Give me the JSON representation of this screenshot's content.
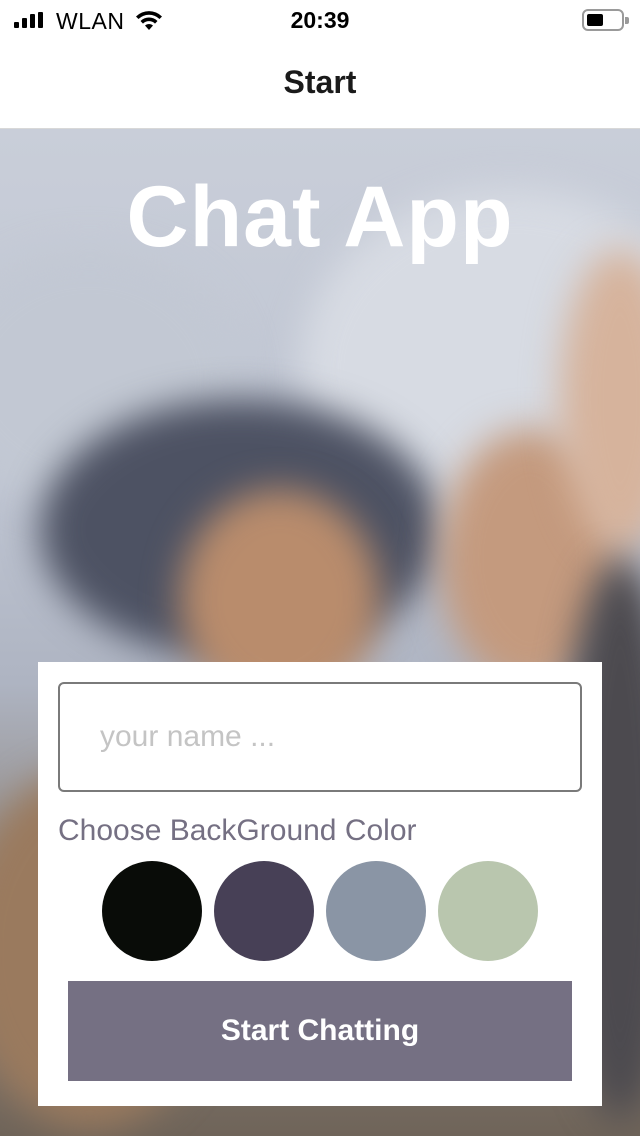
{
  "status_bar": {
    "carrier": "WLAN",
    "time": "20:39",
    "icons": [
      "signal-bars-icon",
      "wifi-icon",
      "battery-icon"
    ]
  },
  "nav": {
    "title": "Start"
  },
  "hero": {
    "app_title": "Chat App"
  },
  "form": {
    "name_placeholder": "your name ...",
    "name_value": "",
    "color_label": "Choose BackGround Color",
    "colors": [
      "#090C08",
      "#474056",
      "#8A95A5",
      "#B9C6AE"
    ],
    "start_button_label": "Start Chatting",
    "accent_color": "#757083"
  }
}
